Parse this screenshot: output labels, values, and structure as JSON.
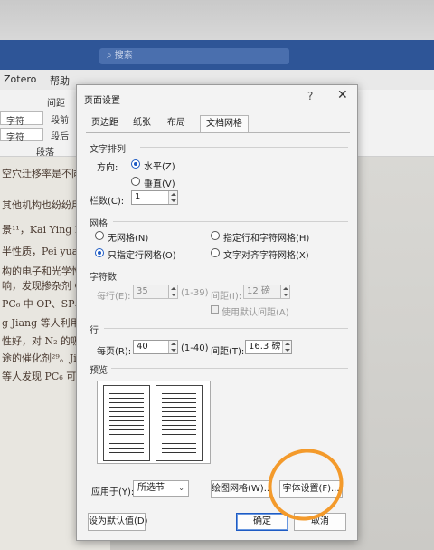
{
  "word": {
    "search_placeholder": "搜索",
    "ribbon_tabs": [
      "Zotero",
      "帮助"
    ],
    "ribbon": {
      "spacing_label": "间距",
      "char_field_1": "字符",
      "char_field_2": "字符",
      "before_label": "段前",
      "after_label": "段后",
      "group_label": "段落"
    },
    "doc_lines": [
      "空穴迁移率是不同",
      "其他机构也纷纷用",
      "景¹¹，Kai Ying Do",
      "半性质，Pei yuan L",
      "构的电子和光学性",
      "响，发现掺杂剂 C",
      "PC₆ 中 OP、SP、",
      "g Jiang 等人利用光",
      "性好，对 N₂ 的吸",
      "途的催化剂²⁹。Ji",
      "等人发现 PC₆ 可以"
    ]
  },
  "dialog": {
    "title": "页面设置",
    "help": "?",
    "close": "✕",
    "tabs": [
      "页边距",
      "纸张",
      "布局",
      "文档网格"
    ],
    "active_tab": "文档网格",
    "text_direction": {
      "group": "文字排列",
      "direction_label": "方向:",
      "horizontal": "水平(Z)",
      "vertical": "垂直(V)",
      "columns_label": "栏数(C):",
      "columns_value": "1"
    },
    "grid": {
      "group": "网格",
      "no_grid": "无网格(N)",
      "specify_line_and_char": "指定行和字符网格(H)",
      "specify_line_only": "只指定行网格(O)",
      "align_to_char": "文字对齐字符网格(X)"
    },
    "characters": {
      "group": "字符数",
      "per_line_label": "每行(E):",
      "per_line_value": "35",
      "per_line_range": "(1-39)",
      "pitch_label": "间距(I):",
      "pitch_value": "12 磅",
      "use_default_pitch": "使用默认间距(A)"
    },
    "lines": {
      "group": "行",
      "per_page_label": "每页(R):",
      "per_page_value": "40",
      "per_page_range": "(1-40)",
      "pitch_label": "间距(T):",
      "pitch_value": "16.3 磅"
    },
    "preview": {
      "group": "预览"
    },
    "apply_to_label": "应用于(Y):",
    "apply_to_value": "所选节",
    "draw_grid_button": "绘图网格(W)...",
    "font_settings_button": "字体设置(F)...",
    "set_default_button": "设为默认值(D)",
    "ok_button": "确定",
    "cancel_button": "取消",
    "colors": {
      "accent": "#1e5bc4",
      "annotation": "#f39a2b",
      "titlebar": "#2e5597"
    }
  }
}
